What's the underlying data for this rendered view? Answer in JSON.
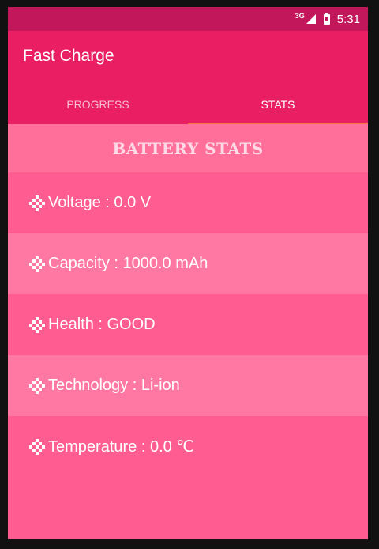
{
  "status_bar": {
    "network": "3G",
    "time": "5:31"
  },
  "app": {
    "title": "Fast Charge"
  },
  "tabs": [
    {
      "label": "PROGRESS",
      "active": false
    },
    {
      "label": "STATS",
      "active": true
    }
  ],
  "section": {
    "title": "BATTERY STATS"
  },
  "stats": [
    {
      "text": "Voltage : 0.0 V"
    },
    {
      "text": "Capacity : 1000.0 mAh"
    },
    {
      "text": "Health : GOOD"
    },
    {
      "text": "Technology : Li-ion"
    },
    {
      "text": "Temperature : 0.0 ℃"
    }
  ],
  "colors": {
    "status_bar": "#c2185b",
    "app_bar": "#e91e63",
    "tab_indicator": "#ff6e40",
    "row_dark": "#ff5d91",
    "row_light": "#ff77a3"
  },
  "icons": {
    "stat_bullet": "checker-icon"
  }
}
